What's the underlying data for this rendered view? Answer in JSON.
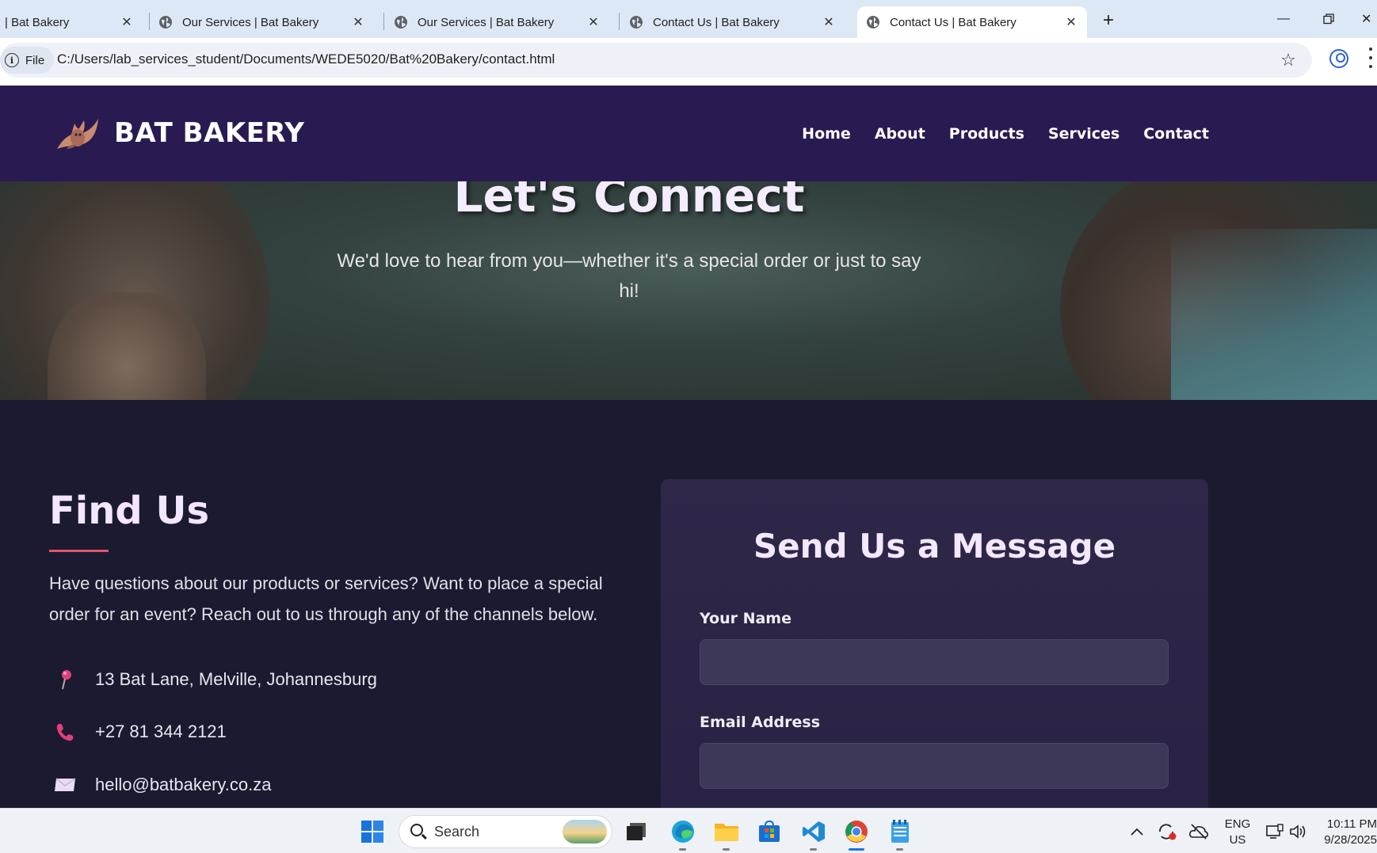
{
  "browser": {
    "tabs": [
      {
        "title": "| Bat Bakery"
      },
      {
        "title": "Our Services | Bat Bakery"
      },
      {
        "title": "Our Services | Bat Bakery"
      },
      {
        "title": "Contact Us | Bat Bakery"
      },
      {
        "title": "Contact Us | Bat Bakery",
        "active": true
      }
    ],
    "new_tab_label": "+",
    "file_chip_label": "File",
    "url": "C:/Users/lab_services_student/Documents/WEDE5020/Bat%20Bakery/contact.html"
  },
  "site": {
    "brand": "BAT BAKERY",
    "nav": [
      "Home",
      "About",
      "Products",
      "Services",
      "Contact"
    ]
  },
  "hero": {
    "title": "Let's Connect",
    "subtitle": "We'd love to hear from you—whether it's a special order or just to say hi!"
  },
  "find_us": {
    "title": "Find Us",
    "description": "Have questions about our products or services? Want to place a special order for an event? Reach out to us through any of the channels below.",
    "address": "13 Bat Lane, Melville, Johannesburg",
    "phone": "+27 81 344 2121",
    "email": "hello@batbakery.co.za"
  },
  "message_form": {
    "title": "Send Us a Message",
    "name_label": "Your Name",
    "email_label": "Email Address"
  },
  "taskbar": {
    "search_label": "Search",
    "language_line1": "ENG",
    "language_line2": "US",
    "time": "10:11 PM",
    "date": "9/28/2025"
  },
  "colors": {
    "header_bg": "#2a1a52",
    "main_bg": "#1b1a30",
    "card_bg": "#2e2748",
    "accent_underline": "#e5546e",
    "icon_pink": "#e0407a"
  }
}
